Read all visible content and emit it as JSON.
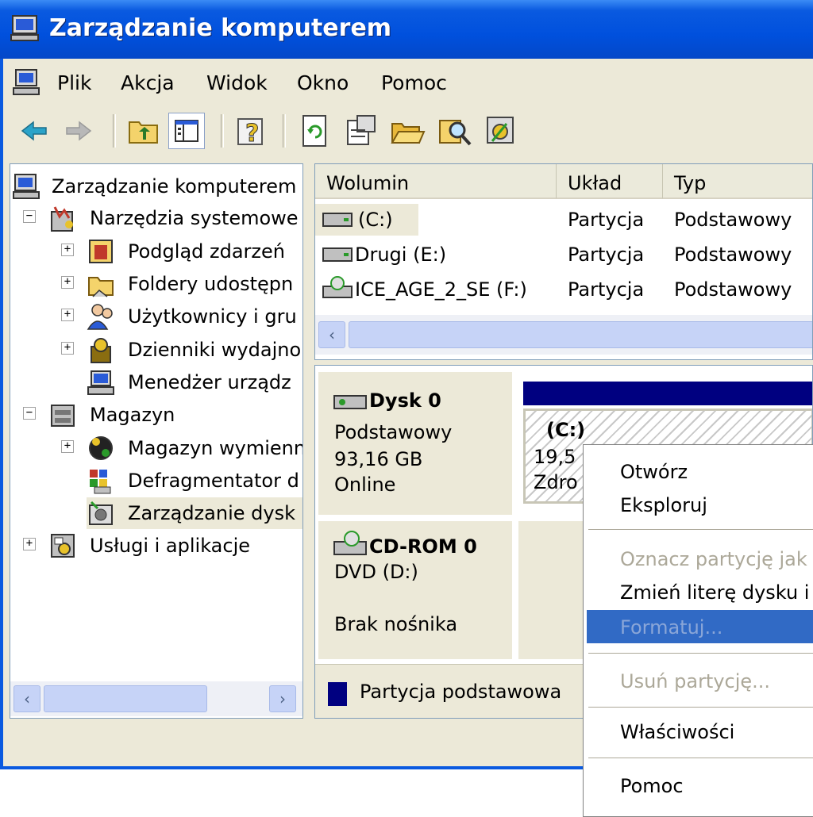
{
  "window": {
    "title": "Zarządzanie komputerem",
    "title_bar_color": "#0050dd"
  },
  "menu": [
    "Plik",
    "Akcja",
    "Widok",
    "Okno",
    "Pomoc"
  ],
  "toolbar": {
    "icons": [
      "back-arrow-icon",
      "forward-arrow-icon",
      "up-folder-icon",
      "show-tree-icon",
      "help-icon",
      "refresh-icon",
      "properties-icon",
      "open-folder-icon",
      "search-icon",
      "disk-settings-icon"
    ]
  },
  "tree": {
    "root": "Zarządzanie komputerem",
    "system_tools": "Narzędzia systemowe",
    "event_viewer": "Podgląd zdarzeń",
    "shared_folders": "Foldery udostępn",
    "users_groups": "Użytkownicy i gru",
    "perf_logs": "Dzienniki wydajno",
    "device_manager": "Menedżer urządz",
    "storage": "Magazyn",
    "removable_storage": "Magazyn wymienn",
    "defragmenter": "Defragmentator d",
    "disk_management": "Zarządzanie dysk",
    "services_apps": "Usługi i aplikacje"
  },
  "volumes": {
    "headers": [
      "Wolumin",
      "Układ",
      "Typ"
    ],
    "rows": [
      {
        "name": "(C:)",
        "layout": "Partycja",
        "type": "Podstawowy"
      },
      {
        "name": "Drugi (E:)",
        "layout": "Partycja",
        "type": "Podstawowy"
      },
      {
        "name": "ICE_AGE_2_SE (F:)",
        "layout": "Partycja",
        "type": "Podstawowy"
      }
    ]
  },
  "disks": {
    "disk0": {
      "name": "Dysk 0",
      "kind": "Podstawowy",
      "size": "93,16 GB",
      "status": "Online"
    },
    "cdrom0": {
      "name": "CD-ROM 0",
      "kind": "DVD (D:)",
      "status": "Brak nośnika"
    },
    "partition_c": {
      "label": "(C:)",
      "size_partial": "19,5",
      "status_partial": "Zdro"
    }
  },
  "legend": {
    "label": "Partycja podstawowa",
    "color": "#000080"
  },
  "context_menu": {
    "open": "Otwórz",
    "explore": "Eksploruj",
    "mark_active": "Oznacz partycję jak",
    "change_letter": "Zmień literę dysku i",
    "format": "Formatuj...",
    "delete": "Usuń partycję...",
    "properties": "Właściwości",
    "help": "Pomoc"
  }
}
